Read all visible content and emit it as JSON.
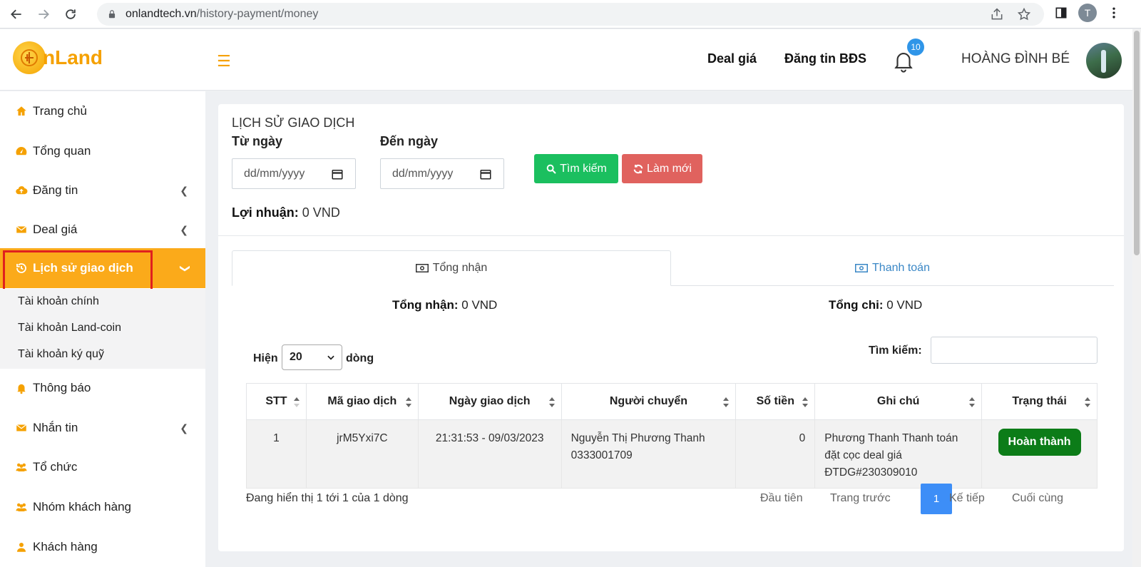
{
  "browser": {
    "url_domain": "onlandtech.vn",
    "url_path": "/history-payment/money",
    "profile_initial": "T"
  },
  "header": {
    "logo_text": "nLand",
    "nav_deal": "Deal giá",
    "nav_post": "Đăng tin BĐS",
    "notification_count": "10",
    "username": "HOÀNG ĐÌNH BÉ"
  },
  "sidebar": {
    "items": [
      {
        "label": "Trang chủ",
        "icon": "home-icon"
      },
      {
        "label": "Tổng quan",
        "icon": "dashboard-icon"
      },
      {
        "label": "Đăng tin",
        "icon": "cloud-upload-icon"
      },
      {
        "label": "Deal giá",
        "icon": "envelope-icon"
      },
      {
        "label": "Lịch sử giao dịch",
        "icon": "history-icon"
      },
      {
        "label": "Thông báo",
        "icon": "bell-icon"
      },
      {
        "label": "Nhắn tin",
        "icon": "envelope-icon"
      },
      {
        "label": "Tổ chức",
        "icon": "users-icon"
      },
      {
        "label": "Nhóm khách hàng",
        "icon": "users-icon"
      },
      {
        "label": "Khách hàng",
        "icon": "user-icon"
      }
    ],
    "submenu": [
      "Tài khoản chính",
      "Tài khoản Land-coin",
      "Tài khoản ký quỹ"
    ]
  },
  "main": {
    "title": "LỊCH SỬ GIAO DỊCH",
    "from_label": "Từ ngày",
    "to_label": "Đến ngày",
    "date_placeholder": "dd/mm/yyyy",
    "search_button": "Tìm kiếm",
    "reset_button": "Làm mới",
    "profit_label": "Lợi nhuận:",
    "profit_value": "0 VND",
    "tabs": [
      {
        "label": "Tổng nhận"
      },
      {
        "label": "Thanh toán"
      }
    ],
    "total_received_label": "Tổng nhận:",
    "total_received_value": "0 VND",
    "total_spent_label": "Tổng chi:",
    "total_spent_value": "0 VND",
    "show_label": "Hiện",
    "rows_value": "20",
    "rows_suffix": "dòng",
    "search_label": "Tìm kiếm:",
    "table": {
      "headers": [
        "STT",
        "Mã giao dịch",
        "Ngày giao dịch",
        "Người chuyển",
        "Số tiền",
        "Ghi chú",
        "Trạng thái"
      ],
      "rows": [
        {
          "stt": "1",
          "code": "jrM5Yxi7C",
          "date": "21:31:53 - 09/03/2023",
          "sender_name": "Nguyễn Thị Phương Thanh",
          "sender_phone": "0333001709",
          "amount": "0",
          "note_line1": "Phương Thanh Thanh toán",
          "note_line2": "đặt cọc deal giá",
          "note_line3": "ĐTDG#230309010",
          "status": "Hoàn thành"
        }
      ]
    },
    "info_text": "Đang hiển thị 1 tới 1 của 1 dòng",
    "pagination": {
      "first": "Đầu tiên",
      "prev": "Trang trước",
      "current": "1",
      "next": "Kế tiếp",
      "last": "Cuối cùng"
    }
  },
  "colors": {
    "brand_orange": "#fbaa1a",
    "success_green": "#1bbf5f",
    "danger_red": "#e0625e",
    "status_green": "#0c7c18",
    "page_blue": "#3d8ef7"
  }
}
